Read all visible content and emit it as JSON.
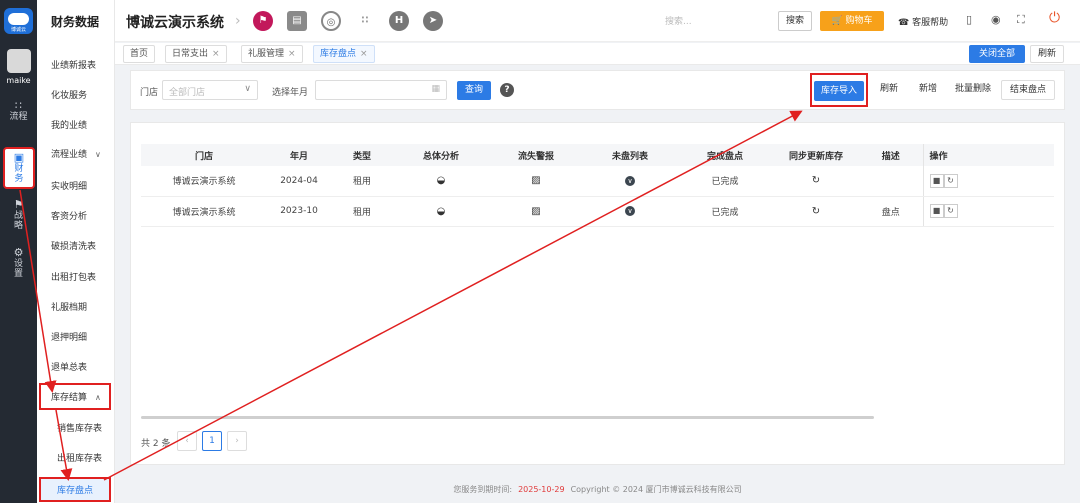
{
  "rail": {
    "logo_text": "博诚云",
    "user": "maike",
    "items": [
      {
        "label": "流程",
        "icon": "flow-icon"
      },
      {
        "label": "财务",
        "icon": "finance-icon"
      },
      {
        "label": "战略",
        "icon": "strategy-icon"
      },
      {
        "label": "设置",
        "icon": "gear-icon"
      }
    ]
  },
  "sidebar": {
    "title": "财务数据",
    "items": [
      "业绩新报表",
      "化妆服务",
      "我的业绩",
      "流程业绩",
      "实收明细",
      "客资分析",
      "破损清洗表",
      "出租打包表",
      "礼服档期",
      "退押明细",
      "退单总表",
      "库存结算",
      "销售库存表",
      "出租库存表",
      "库存盘点"
    ]
  },
  "header": {
    "title": "博诚云演示系统",
    "search_placeholder": "搜索...",
    "search_button": "搜索",
    "cart_button": "购物车",
    "help": "客服帮助"
  },
  "tabs": {
    "items": [
      "首页",
      "日常支出",
      "礼服管理",
      "库存盘点"
    ],
    "close_all": "关闭全部",
    "refresh": "刷新"
  },
  "filter": {
    "store_label": "门店",
    "store_placeholder": "全部门店",
    "month_label": "选择年月",
    "query": "查询",
    "import": "库存导入",
    "refresh": "刷新",
    "add": "新增",
    "batch_delete": "批量删除",
    "finish": "结束盘点"
  },
  "table": {
    "headers": [
      "门店",
      "年月",
      "类型",
      "总体分析",
      "流失警报",
      "未盘列表",
      "完成盘点",
      "同步更新库存",
      "描述",
      "操作"
    ],
    "rows": [
      {
        "store": "博诚云演示系统",
        "month": "2024-04",
        "type": "租用",
        "status": "已完成",
        "desc": ""
      },
      {
        "store": "博诚云演示系统",
        "month": "2023-10",
        "type": "租用",
        "status": "已完成",
        "desc": "盘点"
      }
    ]
  },
  "pager": {
    "total": "共 2 条",
    "current": "1"
  },
  "footer": {
    "expire_label": "您服务到期时间:",
    "expire_date": "2025-10-29",
    "copyright": "Copyright © 2024 厦门市博诚云科技有限公司"
  },
  "colors": {
    "accent": "#2c7be5",
    "annotation": "#e02020",
    "cart": "#f7a11a"
  }
}
